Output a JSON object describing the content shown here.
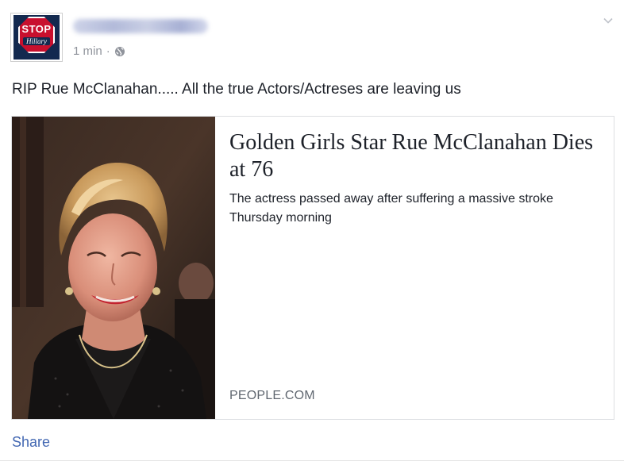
{
  "header": {
    "avatar": {
      "sign_text": "STOP",
      "sub_text": "Hillary",
      "sign_color": "#c8102e",
      "background_color": "#13294f"
    },
    "timestamp": "1 min",
    "separator": "·",
    "privacy_icon": "globe-icon",
    "menu_icon": "chevron-down-icon"
  },
  "post": {
    "status_text": "RIP Rue McClanahan..... All the true Actors/Actreses are leaving us"
  },
  "link_card": {
    "title": "Golden Girls Star Rue McClanahan Dies at 76",
    "description": "The actress passed away after suffering a massive stroke Thursday morning",
    "domain": "PEOPLE.COM"
  },
  "footer": {
    "share_label": "Share",
    "link_color": "#4267b2"
  }
}
